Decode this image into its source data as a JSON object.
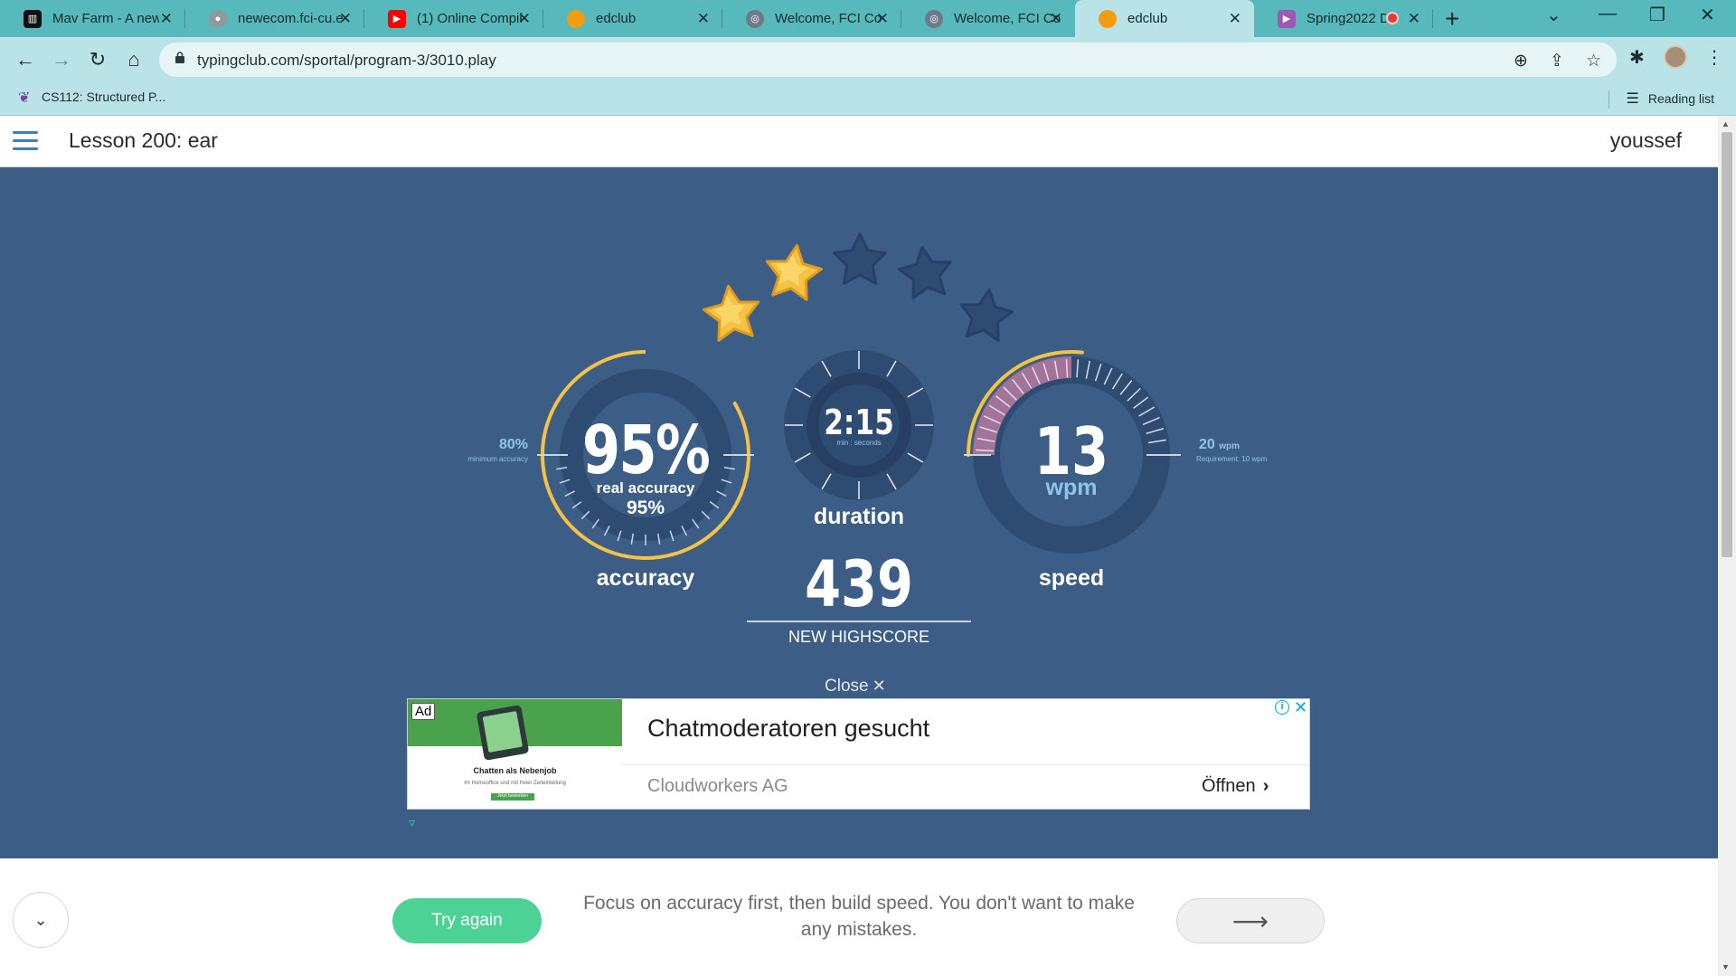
{
  "browser": {
    "tabs": [
      {
        "label": "Mav Farm - A new",
        "icon": "piano-icon",
        "color": "#000000"
      },
      {
        "label": "newecom.fci-cu.e",
        "icon": "globe-icon",
        "color": "#7f8c8d"
      },
      {
        "label": "(1) Online Compil",
        "icon": "youtube-icon",
        "color": "#ff0000"
      },
      {
        "label": "edclub",
        "icon": "edclub-icon",
        "color": "#f39c12"
      },
      {
        "label": "Welcome, FCI Co",
        "icon": "moodle-icon",
        "color": "#6c7a89"
      },
      {
        "label": "Welcome, FCI Co",
        "icon": "moodle-icon",
        "color": "#6c7a89"
      },
      {
        "label": "edclub",
        "icon": "edclub-icon",
        "color": "#f39c12"
      },
      {
        "label": "Spring2022 D",
        "icon": "video-icon",
        "color": "#9b59b6"
      }
    ],
    "url": "typingclub.com/sportal/program-3/3010.play",
    "bookmark": "CS112: Structured P...",
    "reading_list": "Reading list"
  },
  "header": {
    "lesson_title": "Lesson 200: ear",
    "user_name": "youssef"
  },
  "results": {
    "stars_earned": 2,
    "stars_total": 5,
    "accuracy": {
      "value": "95%",
      "real_label": "real accuracy",
      "real_value": "95%",
      "label": "accuracy",
      "min_pct": "80%",
      "min_label": "minimum accuracy",
      "fraction": 0.95
    },
    "duration": {
      "value": "2:15",
      "unit": "min : seconds",
      "label": "duration"
    },
    "score": {
      "value": "439",
      "label": "NEW HIGHSCORE"
    },
    "speed": {
      "value": "13",
      "unit": "wpm",
      "label": "speed",
      "req_value": "20",
      "req_unit": "wpm",
      "req_label": "Requirement: 10 wpm"
    },
    "close_label": "Close"
  },
  "ad": {
    "badge": "Ad",
    "small_title": "Chatten als Nebenjob",
    "small_sub": "Im Homeoffice und mit freier Zeiteinteilung",
    "small_btn": "Jetzt bewerben",
    "headline": "Chatmoderatoren gesucht",
    "company": "Cloudworkers AG",
    "open_label": "Öffnen"
  },
  "footer": {
    "try_again": "Try again",
    "tip": "Focus on accuracy first, then build speed. You don't want to make any mistakes."
  },
  "colors": {
    "panel_bg": "#3c5d86",
    "ring": "#2e4b72",
    "accent_yellow": "#f5c344",
    "speed_pink": "#b77aa0",
    "tab_strip": "#58b9bd",
    "try_again": "#4dd295"
  }
}
